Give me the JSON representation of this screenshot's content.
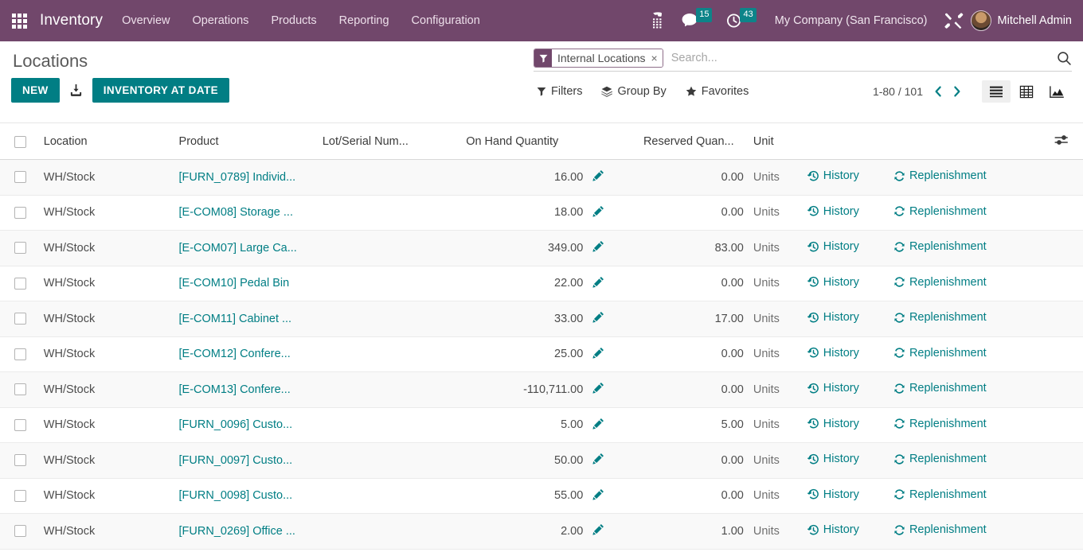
{
  "navbar": {
    "apps_icon": "apps-grid-icon",
    "brand": "Inventory",
    "menus": [
      "Overview",
      "Operations",
      "Products",
      "Reporting",
      "Configuration"
    ],
    "systray": {
      "dialpad_icon": "dialpad-phone-icon",
      "messages_icon": "chat-bubble-icon",
      "messages_count": "15",
      "activities_icon": "clock-icon",
      "activities_count": "43",
      "company": "My Company (San Francisco)",
      "tools_icon": "tools-icon",
      "avatar": "user-avatar",
      "user": "Mitchell Admin"
    },
    "colors": {
      "background": "#71476b",
      "badge": "#0d8489"
    }
  },
  "control_panel": {
    "breadcrumb": "Locations",
    "new_label": "NEW",
    "import_icon": "download-import-icon",
    "inventory_at_date_label": "INVENTORY AT DATE",
    "search": {
      "facet_icon": "filter-funnel-icon",
      "facet_label": "Internal Locations",
      "facet_remove": "×",
      "placeholder": "Search...",
      "value": "",
      "search_icon": "magnifier-icon"
    },
    "filters_label": "Filters",
    "group_by_label": "Group By",
    "favorites_label": "Favorites",
    "pager": "1-80 / 101",
    "prev_icon": "chevron-left-icon",
    "next_icon": "chevron-right-icon",
    "views": [
      {
        "name": "list",
        "icon": "list-view-icon",
        "active": true
      },
      {
        "name": "pivot",
        "icon": "pivot-view-icon",
        "active": false
      },
      {
        "name": "graph",
        "icon": "graph-view-icon",
        "active": false
      }
    ],
    "accent_color": "#017e84"
  },
  "table": {
    "columns": [
      "Location",
      "Product",
      "Lot/Serial Num...",
      "On Hand Quantity",
      "Reserved Quan...",
      "Unit"
    ],
    "optional_columns_icon": "sliders-icon",
    "row_actions": {
      "edit_icon": "pencil-icon",
      "history_icon": "history-rotate-icon",
      "history_label": "History",
      "replenishment_icon": "refresh-icon",
      "replenishment_label": "Replenishment"
    },
    "rows": [
      {
        "location": "WH/Stock",
        "product": "[FURN_0789] Individ...",
        "lot": "",
        "on_hand": "16.00",
        "reserved": "0.00",
        "unit": "Units"
      },
      {
        "location": "WH/Stock",
        "product": "[E-COM08] Storage ...",
        "lot": "",
        "on_hand": "18.00",
        "reserved": "0.00",
        "unit": "Units"
      },
      {
        "location": "WH/Stock",
        "product": "[E-COM07] Large Ca...",
        "lot": "",
        "on_hand": "349.00",
        "reserved": "83.00",
        "unit": "Units"
      },
      {
        "location": "WH/Stock",
        "product": "[E-COM10] Pedal Bin",
        "lot": "",
        "on_hand": "22.00",
        "reserved": "0.00",
        "unit": "Units"
      },
      {
        "location": "WH/Stock",
        "product": "[E-COM11] Cabinet ...",
        "lot": "",
        "on_hand": "33.00",
        "reserved": "17.00",
        "unit": "Units"
      },
      {
        "location": "WH/Stock",
        "product": "[E-COM12] Confere...",
        "lot": "",
        "on_hand": "25.00",
        "reserved": "0.00",
        "unit": "Units"
      },
      {
        "location": "WH/Stock",
        "product": "[E-COM13] Confere...",
        "lot": "",
        "on_hand": "-110,711.00",
        "reserved": "0.00",
        "unit": "Units"
      },
      {
        "location": "WH/Stock",
        "product": "[FURN_0096] Custo...",
        "lot": "",
        "on_hand": "5.00",
        "reserved": "5.00",
        "unit": "Units"
      },
      {
        "location": "WH/Stock",
        "product": "[FURN_0097] Custo...",
        "lot": "",
        "on_hand": "50.00",
        "reserved": "0.00",
        "unit": "Units"
      },
      {
        "location": "WH/Stock",
        "product": "[FURN_0098] Custo...",
        "lot": "",
        "on_hand": "55.00",
        "reserved": "0.00",
        "unit": "Units"
      },
      {
        "location": "WH/Stock",
        "product": "[FURN_0269] Office ...",
        "lot": "",
        "on_hand": "2.00",
        "reserved": "1.00",
        "unit": "Units"
      }
    ]
  }
}
